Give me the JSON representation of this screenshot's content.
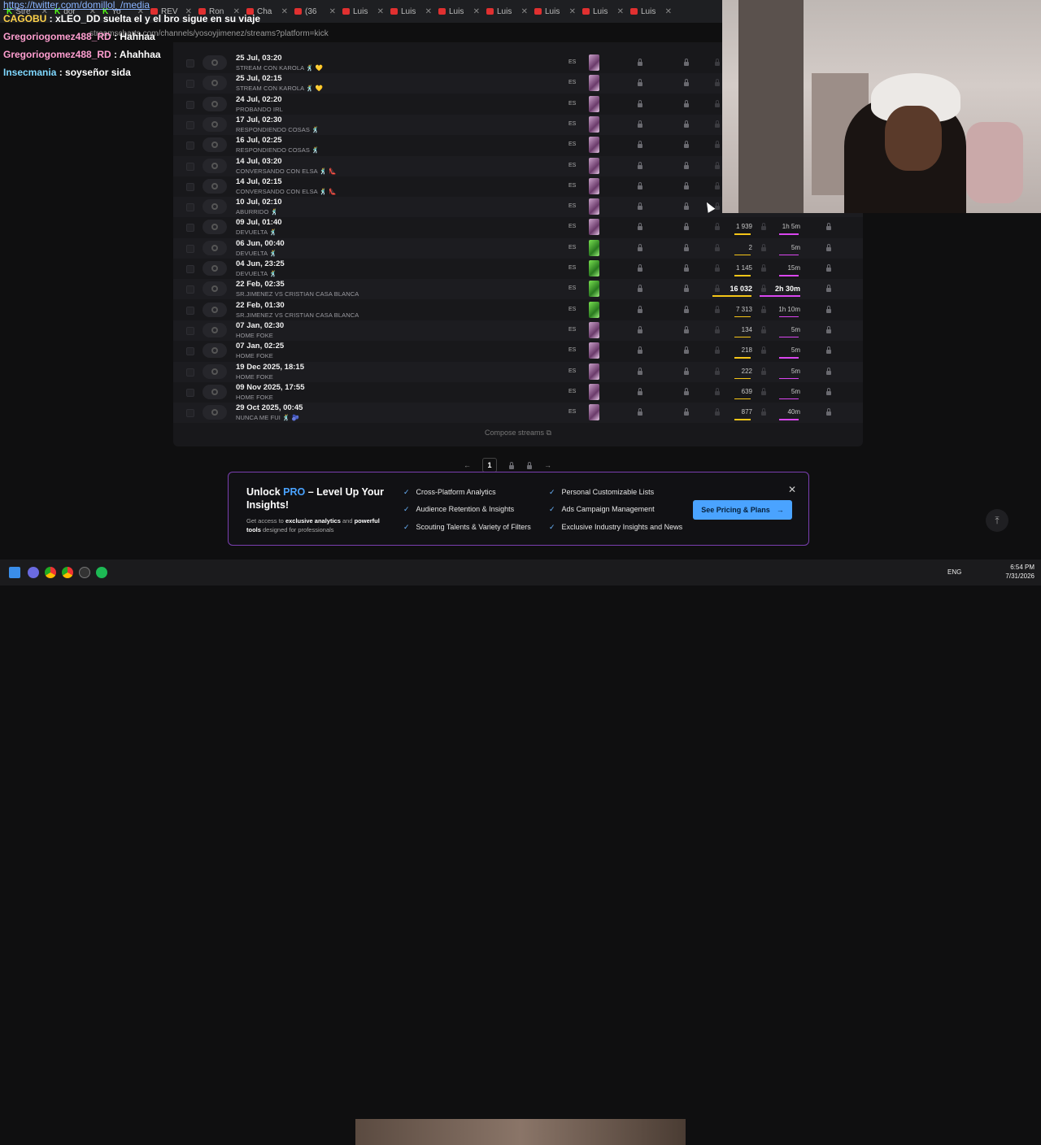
{
  "browser": {
    "tabs": [
      {
        "label": "Stre",
        "icon": "kick-icon"
      },
      {
        "label": "dor",
        "icon": "kick-icon"
      },
      {
        "label": "Yo",
        "icon": "kick-icon"
      },
      {
        "label": "REV",
        "icon": "youtube-icon"
      },
      {
        "label": "Ron",
        "icon": "youtube-icon"
      },
      {
        "label": "Cha",
        "icon": "youtube-icon"
      },
      {
        "label": "(36",
        "icon": "youtube-icon"
      },
      {
        "label": "Luis",
        "icon": "youtube-icon"
      },
      {
        "label": "Luis",
        "icon": "youtube-icon"
      },
      {
        "label": "Luis",
        "icon": "youtube-icon"
      },
      {
        "label": "Luis",
        "icon": "youtube-icon"
      },
      {
        "label": "Luis",
        "icon": "youtube-icon"
      },
      {
        "label": "Luis",
        "icon": "youtube-icon"
      },
      {
        "label": "Luis",
        "icon": "youtube-icon"
      }
    ],
    "url": "streamscharts.com/channels/yosoyjimenez/streams?platform=kick"
  },
  "chat": {
    "link": "https://twitter.com/domillol_/media",
    "messages": [
      {
        "user": "CAGOBU",
        "text": "xLEO_DD suelta el      y el bro sigue en su viaje"
      },
      {
        "user": "Gregoriogomez488_RD",
        "text": "Hahhaa"
      },
      {
        "user": "Gregoriogomez488_RD",
        "text": "Ahahhaa"
      },
      {
        "user": "Insecmania",
        "text": "soyseñor sida"
      }
    ]
  },
  "streams": [
    {
      "date": "25 Jul, 03:20",
      "title": "STREAM CON KAROLA 🕺 💛",
      "lang": "ES",
      "thumb": "pink",
      "viewers": "",
      "duration": ""
    },
    {
      "date": "25 Jul, 02:15",
      "title": "STREAM CON KAROLA 🕺 💛",
      "lang": "ES",
      "thumb": "pink",
      "viewers": "",
      "duration": ""
    },
    {
      "date": "24 Jul, 02:20",
      "title": "PROBANDO IRL",
      "lang": "ES",
      "thumb": "pink",
      "viewers": "",
      "duration": ""
    },
    {
      "date": "17 Jul, 02:30",
      "title": "RESPONDIENDO COSAS 🕺",
      "lang": "ES",
      "thumb": "pink",
      "viewers": "",
      "duration": ""
    },
    {
      "date": "16 Jul, 02:25",
      "title": "RESPONDIENDO COSAS 🕺",
      "lang": "ES",
      "thumb": "pink",
      "viewers": "",
      "duration": ""
    },
    {
      "date": "14 Jul, 03:20",
      "title": "Conversando con Elsa 🕺 👠",
      "lang": "ES",
      "thumb": "pink",
      "viewers": "",
      "duration": ""
    },
    {
      "date": "14 Jul, 02:15",
      "title": "Conversando con Elsa 🕺 👠",
      "lang": "ES",
      "thumb": "pink",
      "viewers": "",
      "duration": ""
    },
    {
      "date": "10 Jul, 02:10",
      "title": "ABURRIDO 🕺",
      "lang": "ES",
      "thumb": "pink",
      "viewers": "",
      "duration": ""
    },
    {
      "date": "09 Jul, 01:40",
      "title": "DEVUELTA 🕺",
      "lang": "ES",
      "thumb": "pink",
      "viewers": "1 939",
      "duration": "1h 5m"
    },
    {
      "date": "06 Jun, 00:40",
      "title": "DEVUELTA 🕺",
      "lang": "ES",
      "thumb": "green",
      "viewers": "2",
      "duration": "5m"
    },
    {
      "date": "04 Jun, 23:25",
      "title": "DEVUELTA 🕺",
      "lang": "ES",
      "thumb": "green",
      "viewers": "1 145",
      "duration": "15m"
    },
    {
      "date": "22 Feb, 02:35",
      "title": "SR.JIMENEZ VS CRISTIAN CASA BLANCA",
      "lang": "ES",
      "thumb": "green",
      "viewers": "16 032",
      "duration": "2h 30m",
      "bold": true
    },
    {
      "date": "22 Feb, 01:30",
      "title": "SR.JIMENEZ VS CRISTIAN CASA BLANCA",
      "lang": "ES",
      "thumb": "green",
      "viewers": "7 313",
      "duration": "1h 10m"
    },
    {
      "date": "07 Jan, 02:30",
      "title": "HOME FOKE",
      "lang": "ES",
      "thumb": "pink",
      "viewers": "134",
      "duration": "5m"
    },
    {
      "date": "07 Jan, 02:25",
      "title": "HOME FOKE",
      "lang": "ES",
      "thumb": "pink",
      "viewers": "218",
      "duration": "5m"
    },
    {
      "date": "19 Dec 2025, 18:15",
      "title": "HOME FOKE",
      "lang": "ES",
      "thumb": "pink",
      "viewers": "222",
      "duration": "5m"
    },
    {
      "date": "09 Nov 2025, 17:55",
      "title": "HOME FOKE",
      "lang": "ES",
      "thumb": "pink",
      "viewers": "639",
      "duration": "5m"
    },
    {
      "date": "29 Oct 2025, 00:45",
      "title": "NUNCA ME FUI 🕺 🫐",
      "lang": "ES",
      "thumb": "pink",
      "viewers": "877",
      "duration": "40m"
    }
  ],
  "compose_label": "Compose streams",
  "pager": {
    "prev": "←",
    "current": "1",
    "next": "→"
  },
  "promo": {
    "title_pre": "Unlock ",
    "title_pro": "PRO",
    "title_post": " – Level Up Your Insights!",
    "sub_pre": "Get access to ",
    "sub_b1": "exclusive analytics",
    "sub_mid": " and ",
    "sub_b2": "powerful tools",
    "sub_post": " designed for professionals",
    "features": [
      "Cross-Platform Analytics",
      "Audience Retention & Insights",
      "Scouting Talents & Variety of Filters",
      "Personal Customizable Lists",
      "Ads Campaign Management",
      "Exclusive Industry Insights and News"
    ],
    "cta": "See Pricing & Plans",
    "close": "✕"
  },
  "taskbar": {
    "lang": "ENG",
    "time": "6:54 PM",
    "date": "7/31/2026"
  },
  "colors": {
    "accent": "#4aa3ff",
    "viewers_bar": "#f5c518",
    "duration_bar": "#d946ef",
    "promo_border": "#7a3fb0"
  }
}
